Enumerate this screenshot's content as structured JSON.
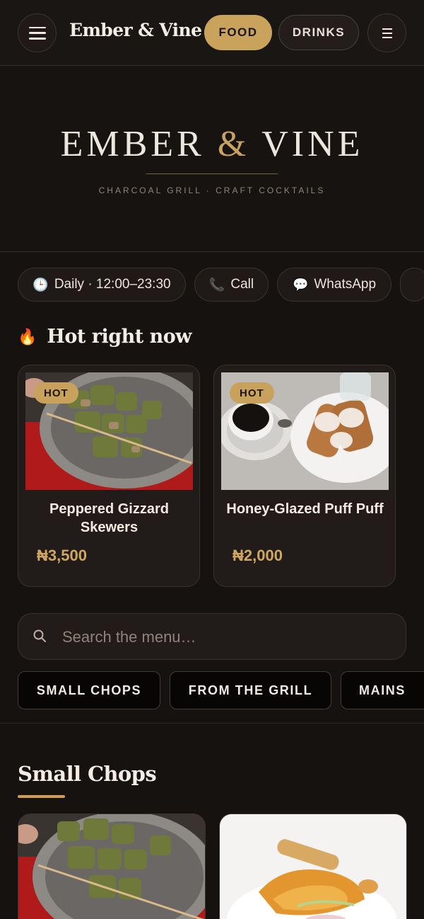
{
  "header": {
    "brand": "Ember & Vine",
    "tabs": [
      {
        "label": "FOOD",
        "active": true
      },
      {
        "label": "DRINKS",
        "active": false
      }
    ]
  },
  "hero": {
    "logo_left": "EMBER",
    "logo_amp": "&",
    "logo_right": "VINE",
    "tagline": "CHARCOAL GRILL · CRAFT COCKTAILS"
  },
  "info_pills": {
    "hours": "Daily · 12:00–23:30",
    "call": "Call",
    "whatsapp": "WhatsApp"
  },
  "hot_section": {
    "title": "Hot right now",
    "items": [
      {
        "badge": "HOT",
        "name": "Peppered Gizzard Skewers",
        "price": "₦3,500"
      },
      {
        "badge": "HOT",
        "name": "Honey-Glazed Puff Puff",
        "price": "₦2,000"
      }
    ]
  },
  "search": {
    "placeholder": "Search the menu…"
  },
  "categories": [
    "SMALL CHOPS",
    "FROM THE GRILL",
    "MAINS"
  ],
  "menu_section": {
    "title": "Small Chops"
  },
  "colors": {
    "background": "#161210",
    "accent_gold": "#c9a25c",
    "price_gold": "#cfa761",
    "underline": "#d39b4c"
  },
  "icons": [
    "hamburger-menu-icon",
    "list-icon",
    "clock-icon",
    "phone-icon",
    "speech-bubble-icon",
    "fire-icon",
    "search-icon"
  ]
}
